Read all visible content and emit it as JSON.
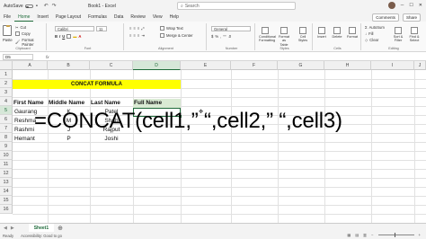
{
  "titlebar": {
    "autosave_label": "AutoSave",
    "title": "Book1 - Excel",
    "search_placeholder": "Search"
  },
  "tabs": [
    "File",
    "Home",
    "Insert",
    "Page Layout",
    "Formulas",
    "Data",
    "Review",
    "View",
    "Help"
  ],
  "tabs_right": {
    "comments": "Comments",
    "share": "Share"
  },
  "ribbon": {
    "clipboard": {
      "paste": "Paste",
      "cut": "Cut",
      "copy": "Copy",
      "format_painter": "Format Painter",
      "label": "Clipboard"
    },
    "font": {
      "name": "Calibri",
      "size": "11",
      "label": "Font"
    },
    "alignment": {
      "wrap": "Wrap Text",
      "merge": "Merge & Center",
      "label": "Alignment"
    },
    "number": {
      "format": "General",
      "label": "Number"
    },
    "styles": {
      "conditional": "Conditional Formatting",
      "table": "Format as Table",
      "cell": "Cell Styles",
      "label": "Styles"
    },
    "cells": {
      "insert": "Insert",
      "delete": "Delete",
      "format": "Format",
      "label": "Cells"
    },
    "editing": {
      "autosum": "AutoSum",
      "fill": "Fill",
      "clear": "Clear",
      "sort": "Sort & Filter",
      "find": "Find & Select",
      "label": "Editing"
    }
  },
  "formula_bar": {
    "name_box": "D5",
    "fx": "fx"
  },
  "columns": [
    "A",
    "B",
    "C",
    "D",
    "E",
    "F",
    "G",
    "H",
    "I",
    "J"
  ],
  "rows": [
    "1",
    "2",
    "3",
    "4",
    "5",
    "6",
    "7",
    "8",
    "9",
    "10",
    "11",
    "12",
    "13",
    "14",
    "15",
    "16"
  ],
  "sheet": {
    "title": "CONCAT FORMULA",
    "headers": {
      "first": "First Name",
      "middle": "Middle Name",
      "last": "Last Name",
      "full": "Full Name"
    },
    "data": [
      {
        "first": "Gaurang",
        "middle": "K",
        "last": "Patel"
      },
      {
        "first": "Reshma",
        "middle": "M",
        "last": "Shah"
      },
      {
        "first": "Rashmi",
        "middle": "J",
        "last": "Rajput"
      },
      {
        "first": "Hemant",
        "middle": "P",
        "last": "Joshi"
      }
    ]
  },
  "overlay_formula": "=CONCAT(cell1,” “,cell2,” “,cell3)",
  "sheettabs": {
    "active": "Sheet1"
  },
  "status": {
    "ready": "Ready",
    "accessibility": "Accessibility: Good to go"
  }
}
